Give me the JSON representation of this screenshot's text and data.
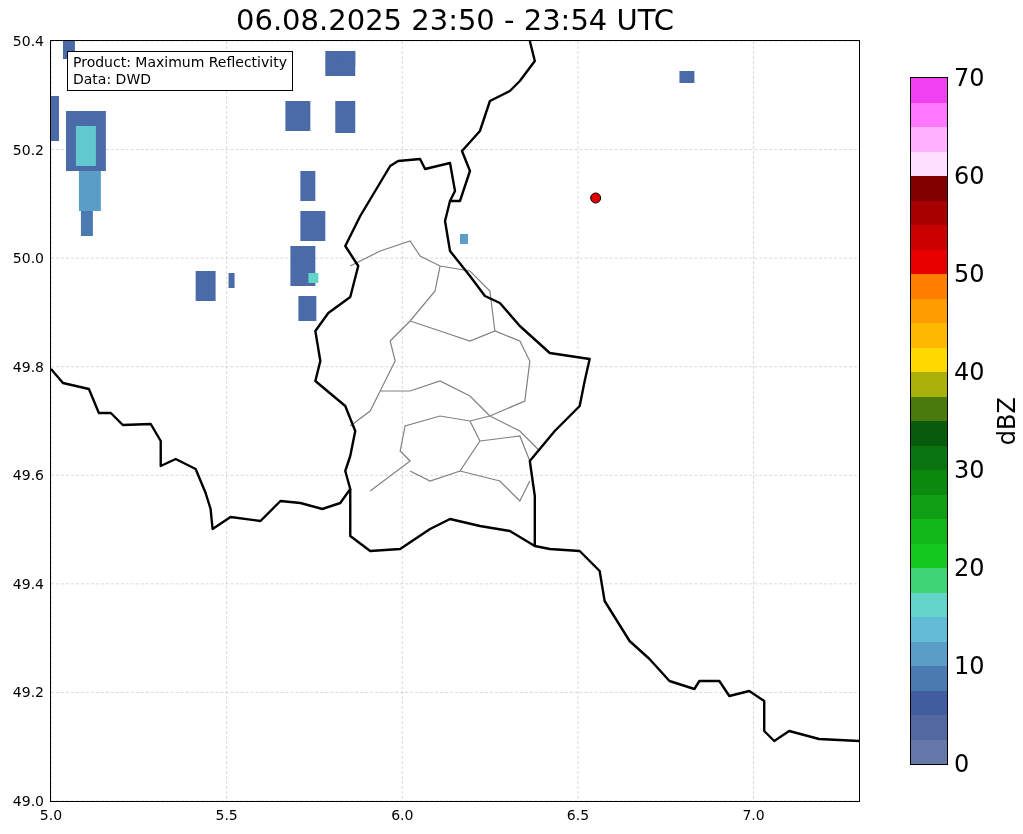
{
  "title": "06.08.2025 23:50 - 23:54 UTC",
  "legend": {
    "lines": [
      "Product: Maximum Reflectivity",
      "Data: DWD"
    ]
  },
  "map": {
    "xticks": [
      "5.0",
      "5.5",
      "6.0",
      "6.5",
      "7.0"
    ],
    "yticks": [
      "50.4",
      "50.2",
      "50.0",
      "49.8",
      "49.6",
      "49.4",
      "49.2",
      "49.0"
    ]
  },
  "colorbar": {
    "label": "dBZ",
    "ticks": [
      "70",
      "60",
      "50",
      "40",
      "30",
      "20",
      "10",
      "0"
    ],
    "bands": [
      {
        "color": "#f040f0"
      },
      {
        "color": "#ff78ff"
      },
      {
        "color": "#ffb0ff"
      },
      {
        "color": "#ffe0ff"
      },
      {
        "color": "#800000"
      },
      {
        "color": "#a80000"
      },
      {
        "color": "#cc0000"
      },
      {
        "color": "#e80000"
      },
      {
        "color": "#ff7e00"
      },
      {
        "color": "#ff9c00"
      },
      {
        "color": "#ffb800"
      },
      {
        "color": "#ffd800"
      },
      {
        "color": "#aab00a"
      },
      {
        "color": "#4a7a0c"
      },
      {
        "color": "#085a0c"
      },
      {
        "color": "#0a7410"
      },
      {
        "color": "#0c8a10"
      },
      {
        "color": "#109e14"
      },
      {
        "color": "#12b81a"
      },
      {
        "color": "#14c820"
      },
      {
        "color": "#3ed674"
      },
      {
        "color": "#62d4c8"
      },
      {
        "color": "#62bcd8"
      },
      {
        "color": "#5a9ec8"
      },
      {
        "color": "#4a7ab0"
      },
      {
        "color": "#425d9f"
      },
      {
        "color": "#5468a0"
      },
      {
        "color": "#6678a9"
      }
    ]
  }
}
